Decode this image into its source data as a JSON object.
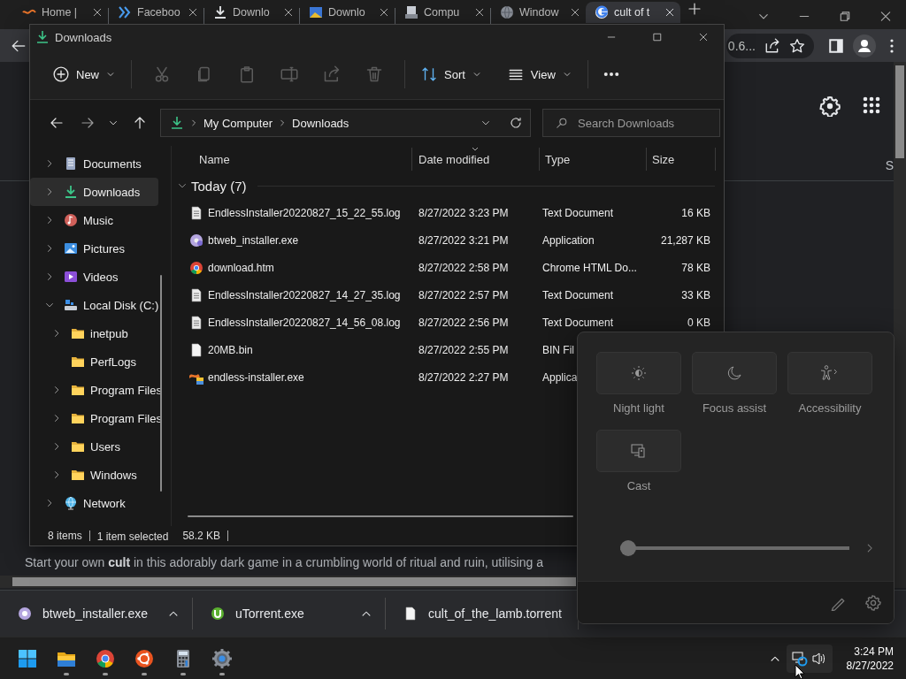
{
  "browser": {
    "tabs": [
      {
        "title": "Home |",
        "selected": false
      },
      {
        "title": "Faceboo",
        "selected": false
      },
      {
        "title": "Downlo",
        "selected": false
      },
      {
        "title": "Downlo",
        "selected": false
      },
      {
        "title": "Compu",
        "selected": false
      },
      {
        "title": "Window",
        "selected": false
      },
      {
        "title": "cult of t",
        "selected": true
      }
    ],
    "address_fragment": "0.6...",
    "page": {
      "tab_fragment": "S",
      "text": "Start your own **cult** in this adorably dark game in a crumbling world of ritual and ruin, utilising a"
    },
    "downloads": [
      {
        "name": "btweb_installer.exe",
        "caret": true
      },
      {
        "name": "uTorrent.exe",
        "caret": true
      },
      {
        "name": "cult_of_the_lamb.torrent",
        "caret": false
      }
    ]
  },
  "explorer": {
    "title": "Downloads",
    "toolbar": {
      "new": "New",
      "edit_actions": [
        {
          "disabled": true
        },
        {
          "disabled": true
        },
        {
          "disabled": true
        },
        {
          "disabled": true
        },
        {
          "disabled": true
        },
        {
          "disabled": true
        }
      ],
      "sort": "Sort",
      "view": "View"
    },
    "path": [
      "My Computer",
      "Downloads"
    ],
    "search": {
      "placeholder": "Search Downloads"
    },
    "nav": [
      {
        "kind": "documents",
        "label": "Documents",
        "selected": false,
        "expandable": true,
        "expanded": false
      },
      {
        "kind": "downloads",
        "label": "Downloads",
        "selected": true,
        "expandable": true,
        "expanded": false
      },
      {
        "kind": "music",
        "label": "Music",
        "selected": false,
        "expandable": true,
        "expanded": false
      },
      {
        "kind": "pictures",
        "label": "Pictures",
        "selected": false,
        "expandable": true,
        "expanded": false
      },
      {
        "kind": "videos",
        "label": "Videos",
        "selected": false,
        "expandable": true,
        "expanded": false
      },
      {
        "kind": "drive",
        "label": "Local Disk (C:)",
        "selected": false,
        "expandable": true,
        "expanded": true,
        "children": [
          {
            "kind": "folder",
            "label": "inetpub",
            "selected": false,
            "expandable": true
          },
          {
            "kind": "folder",
            "label": "PerfLogs",
            "selected": false,
            "expandable": false
          },
          {
            "kind": "folder",
            "label": "Program Files",
            "selected": false,
            "expandable": true
          },
          {
            "kind": "folder",
            "label": "Program Files",
            "selected": false,
            "expandable": true
          },
          {
            "kind": "folder",
            "label": "Users",
            "selected": false,
            "expandable": true
          },
          {
            "kind": "folder",
            "label": "Windows",
            "selected": false,
            "expandable": true
          }
        ]
      },
      {
        "kind": "network",
        "label": "Network",
        "selected": false,
        "expandable": true,
        "expanded": false
      }
    ],
    "columns": [
      "Name",
      "Date modified",
      "Type",
      "Size"
    ],
    "groups": [
      {
        "label": "Today (7)",
        "expanded": true,
        "files": [
          {
            "kind": "document",
            "name": "EndlessInstaller20220827_15_22_55.log",
            "date": "8/27/2022 3:23 PM",
            "type": "Text Document",
            "size": "16 KB"
          },
          {
            "kind": "disc",
            "name": "btweb_installer.exe",
            "date": "8/27/2022 3:21 PM",
            "type": "Application",
            "size": "21,287 KB"
          },
          {
            "kind": "browser",
            "name": "download.htm",
            "date": "8/27/2022 2:58 PM",
            "type": "Chrome HTML Do...",
            "size": "78 KB"
          },
          {
            "kind": "document",
            "name": "EndlessInstaller20220827_14_27_35.log",
            "date": "8/27/2022 2:57 PM",
            "type": "Text Document",
            "size": "33 KB"
          },
          {
            "kind": "document",
            "name": "EndlessInstaller20220827_14_56_08.log",
            "date": "8/27/2022 2:56 PM",
            "type": "Text Document",
            "size": "0 KB"
          },
          {
            "kind": "blank",
            "name": "20MB.bin",
            "date": "8/27/2022 2:55 PM",
            "type": "BIN Fil"
          },
          {
            "kind": "installer",
            "name": "endless-installer.exe",
            "date": "8/27/2022 2:27 PM",
            "type": "Applica"
          }
        ]
      }
    ],
    "status_bar": [
      "8 items",
      "1 item selected",
      "58.2 KB"
    ]
  },
  "quick_settings": {
    "tiles": [
      {
        "label": "Night light",
        "on": false
      },
      {
        "label": "Focus assist",
        "on": false
      },
      {
        "label": "Accessibility",
        "on": false
      },
      {
        "label": "Cast",
        "on": false
      }
    ],
    "brightness": {
      "level": 0
    }
  },
  "taskbar": {
    "apps": [
      {
        "running": true
      },
      {
        "running": true
      },
      {
        "running": true
      },
      {
        "running": true
      },
      {
        "running": true
      }
    ],
    "time": "3:24 PM",
    "date": "8/27/2022"
  }
}
